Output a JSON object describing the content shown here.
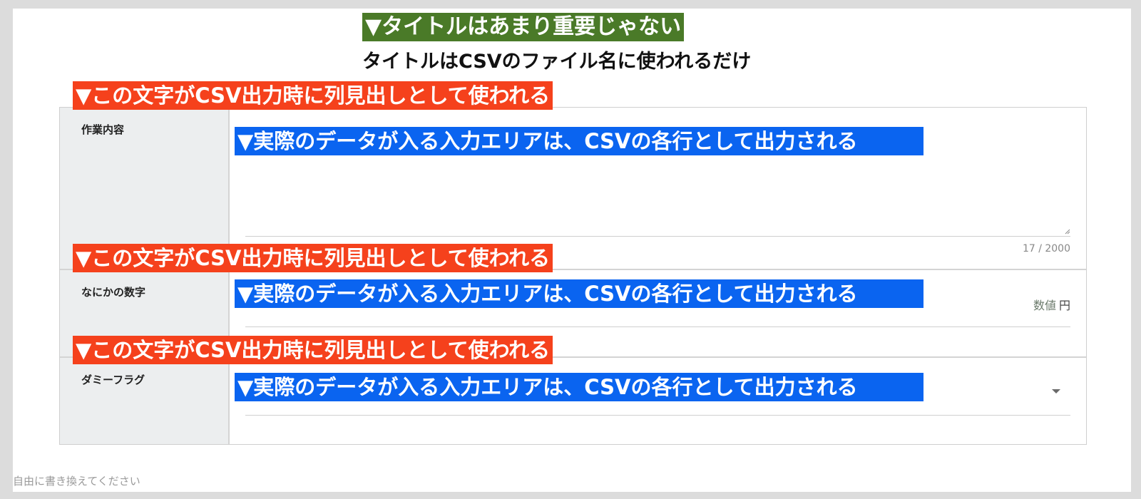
{
  "title_banner": "▼タイトルはあまり重要じゃない",
  "title_note": "タイトルはCSVのファイル名に使われるだけ",
  "column_note": "▼この文字がCSV出力時に列見出しとして使われる",
  "data_note": "▼実際のデータが入る入力エリアは、CSVの各行として出力される",
  "fields": [
    {
      "label": "作業内容",
      "counter": "17 / 2000"
    },
    {
      "label": "なにかの数字",
      "suffix_placeholder": "数値",
      "unit": "円"
    },
    {
      "label": "ダミーフラグ"
    }
  ],
  "footer_note": "自由に書き換えてください",
  "colors": {
    "title_banner": "#4a7a28",
    "column_banner": "#f5411c",
    "data_banner": "#0a64f0"
  }
}
